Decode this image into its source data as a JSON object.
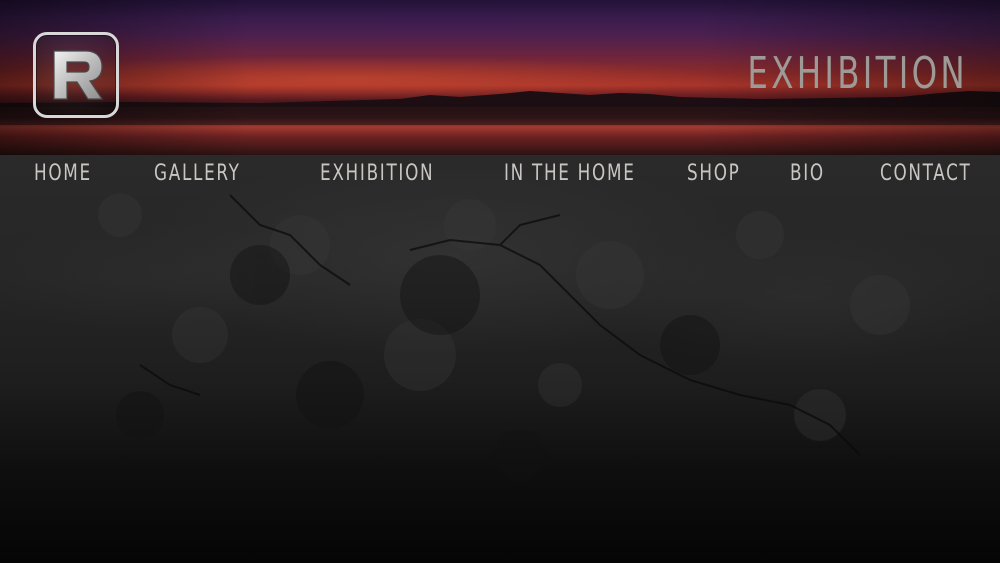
{
  "header": {
    "logo_icon": "r-logo-icon",
    "page_title": "EXHIBITION"
  },
  "nav": {
    "items": [
      {
        "label": "HOME"
      },
      {
        "label": "GALLERY"
      },
      {
        "label": "EXHIBITION"
      },
      {
        "label": "IN THE HOME"
      },
      {
        "label": "SHOP"
      },
      {
        "label": "BIO"
      },
      {
        "label": "CONTACT"
      }
    ]
  },
  "colors": {
    "nav_text": "#c9c6c2",
    "title_text": "#9d9a97",
    "background": "#0a0a0a",
    "banner_accent": "#a8342a"
  }
}
